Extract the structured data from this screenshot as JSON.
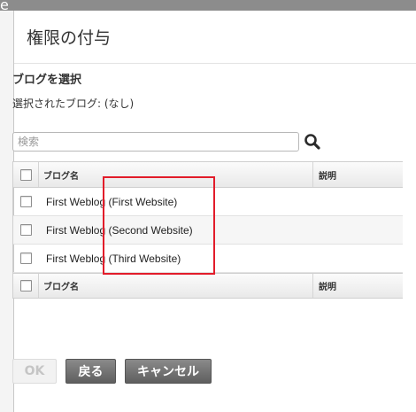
{
  "background": {
    "letter": "e"
  },
  "dialog": {
    "title": "権限の付与",
    "section_heading": "ブログを選択",
    "selected_text": "選択されたブログ: (なし)",
    "search": {
      "placeholder": "検索",
      "value": "",
      "button_icon": "search-icon"
    },
    "table": {
      "header": {
        "name": "ブログ名",
        "description": "説明"
      },
      "rows": [
        {
          "name": "First Weblog (First Website)",
          "description": ""
        },
        {
          "name": "First Weblog (Second Website)",
          "description": ""
        },
        {
          "name": "First Weblog (Third Website)",
          "description": ""
        }
      ],
      "footer": {
        "name": "ブログ名",
        "description": "説明"
      }
    },
    "buttons": {
      "ok": "OK",
      "back": "戻る",
      "cancel": "キャンセル"
    },
    "highlight_color": "#e21c2a"
  }
}
